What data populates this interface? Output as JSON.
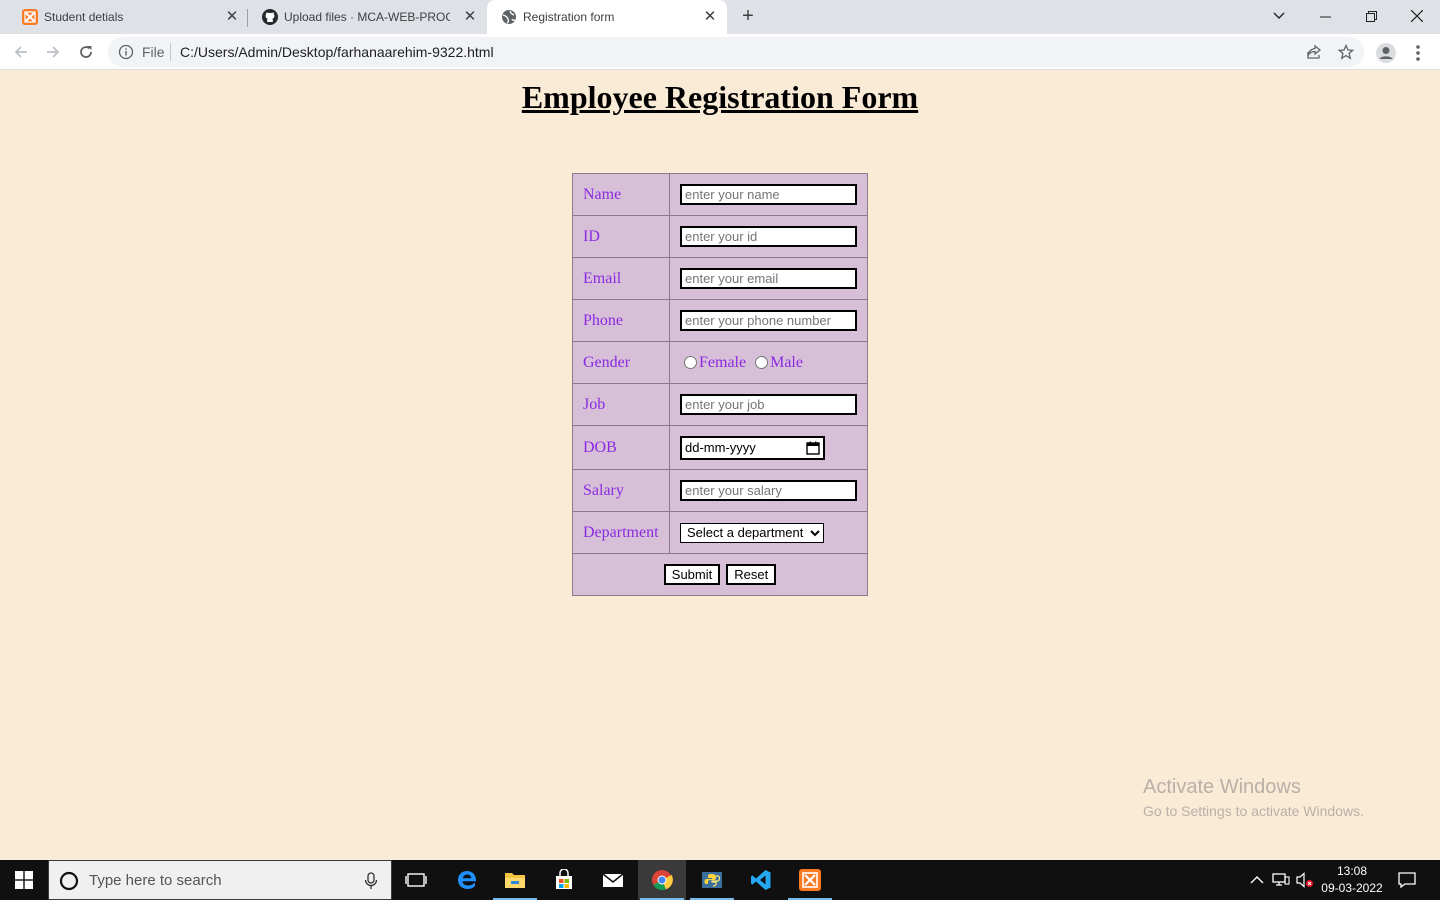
{
  "browser": {
    "tabs": [
      {
        "title": "Student detials",
        "icon": "xampp-icon",
        "active": false
      },
      {
        "title": "Upload files · MCA-WEB-PROGRA",
        "icon": "github-icon",
        "active": false
      },
      {
        "title": "Registration form",
        "icon": "globe-icon",
        "active": true
      }
    ],
    "address": {
      "scheme_label": "File",
      "url": "C:/Users/Admin/Desktop/farhanaarehim-9322.html"
    }
  },
  "page": {
    "title": "Employee Registration Form",
    "fields": {
      "name": {
        "label": "Name",
        "placeholder": "enter your name"
      },
      "id": {
        "label": "ID",
        "placeholder": "enter your id"
      },
      "email": {
        "label": "Email",
        "placeholder": "enter your email"
      },
      "phone": {
        "label": "Phone",
        "placeholder": "enter your phone number"
      },
      "gender": {
        "label": "Gender",
        "options": [
          "Female",
          "Male"
        ]
      },
      "job": {
        "label": "Job",
        "placeholder": "enter your job"
      },
      "dob": {
        "label": "DOB",
        "placeholder": "dd-mm-yyyy"
      },
      "salary": {
        "label": "Salary",
        "placeholder": "enter your salary"
      },
      "department": {
        "label": "Department",
        "selected": "Select a department"
      }
    },
    "buttons": {
      "submit": "Submit",
      "reset": "Reset"
    },
    "colors": {
      "background": "#faebd7",
      "table": "#d8bfd8",
      "label": "#8a2be2"
    }
  },
  "watermark": {
    "title": "Activate Windows",
    "subtitle": "Go to Settings to activate Windows."
  },
  "taskbar": {
    "search_placeholder": "Type here to search",
    "time": "13:08",
    "date": "09-03-2022",
    "apps": [
      "task-view-icon",
      "edge-icon",
      "file-explorer-icon",
      "store-icon",
      "mail-icon",
      "chrome-icon",
      "python-icon",
      "vscode-icon",
      "xampp-icon"
    ]
  }
}
